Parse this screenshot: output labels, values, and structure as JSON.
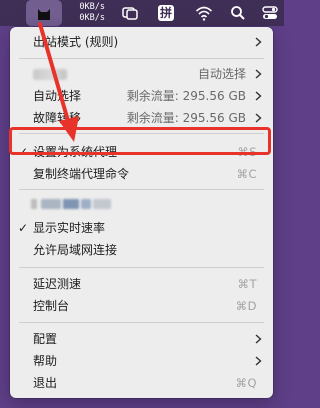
{
  "menubar": {
    "speed_up": "0KB/s",
    "speed_down": "0KB/s",
    "icons": [
      "cat-app-icon",
      "window-overlap-icon",
      "input-method-icon",
      "wifi-icon",
      "search-icon",
      "control-center-icon"
    ],
    "input_method_label": "拼"
  },
  "menu": {
    "outbound_mode": "出站模式 (规则)",
    "proxy_group_selection": "自动选择",
    "auto_select_label": "自动选择",
    "auto_select_traffic": "剩余流量: 295.56 GB",
    "fallback_label": "故障转移",
    "fallback_traffic": "剩余流量: 295.56 GB",
    "set_system_proxy": "设置为系统代理",
    "set_system_proxy_shortcut": "⌘S",
    "set_system_proxy_checked": "✓",
    "copy_terminal_cmd": "复制终端代理命令",
    "copy_terminal_cmd_shortcut": "⌘C",
    "show_speed": "显示实时速率",
    "show_speed_checked": "✓",
    "allow_lan": "允许局域网连接",
    "latency_test": "延迟测速",
    "latency_test_shortcut": "⌘T",
    "dashboard": "控制台",
    "dashboard_shortcut": "⌘D",
    "config": "配置",
    "help": "帮助",
    "quit": "退出",
    "quit_shortcut": "⌘Q"
  },
  "colors": {
    "menu_bg": "#ededed",
    "annotation_red": "#e8332a",
    "desktop": "#5e3f88"
  }
}
